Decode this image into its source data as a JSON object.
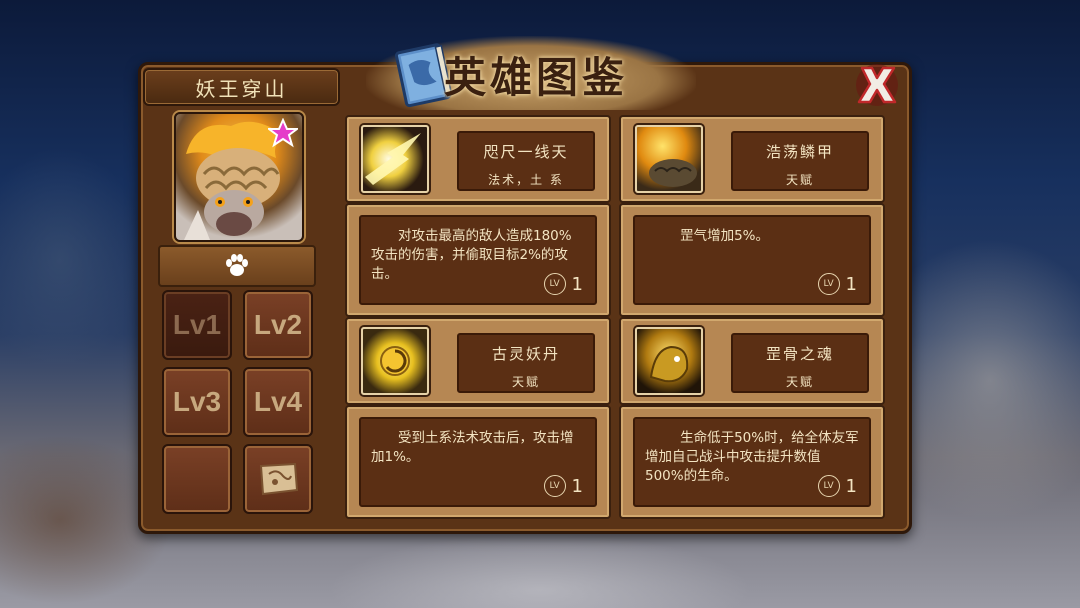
{
  "title": "英雄图鉴",
  "hero": {
    "name": "妖王穿山",
    "star_icon": "pink-star-icon"
  },
  "pet_button": {
    "icon": "paw-icon"
  },
  "level_buttons": [
    "Lv1",
    "Lv2",
    "Lv3",
    "Lv4"
  ],
  "extra_buttons": [
    {
      "icon": ""
    },
    {
      "icon": "scroll-map-icon"
    }
  ],
  "skills": [
    {
      "name": "咫尺一线天",
      "type": "法术，土 系",
      "icon": "lightning-slash-icon",
      "description": "对攻击最高的敌人造成180%攻击的伤害，并偷取目标2%的攻击。",
      "level_badge": "LV",
      "level": "1"
    },
    {
      "name": "浩荡鳞甲",
      "type": "天赋",
      "icon": "golden-scale-armor-icon",
      "description": "罡气增加5%。",
      "level_badge": "LV",
      "level": "1"
    },
    {
      "name": "古灵妖丹",
      "type": "天赋",
      "icon": "demon-orb-icon",
      "description": "受到土系法术攻击后，攻击增加1%。",
      "level_badge": "LV",
      "level": "1"
    },
    {
      "name": "罡骨之魂",
      "type": "天赋",
      "icon": "golden-beast-soul-icon",
      "description": "生命低于50%时，给全体友军增加自己战斗中攻击提升数值500%的生命。",
      "level_badge": "LV",
      "level": "1"
    }
  ],
  "colors": {
    "frame": "#5a3316",
    "card": "#b68753",
    "card_inner": "#5b2f14",
    "text": "#f3e4c2",
    "close_red": "#c0282a"
  }
}
